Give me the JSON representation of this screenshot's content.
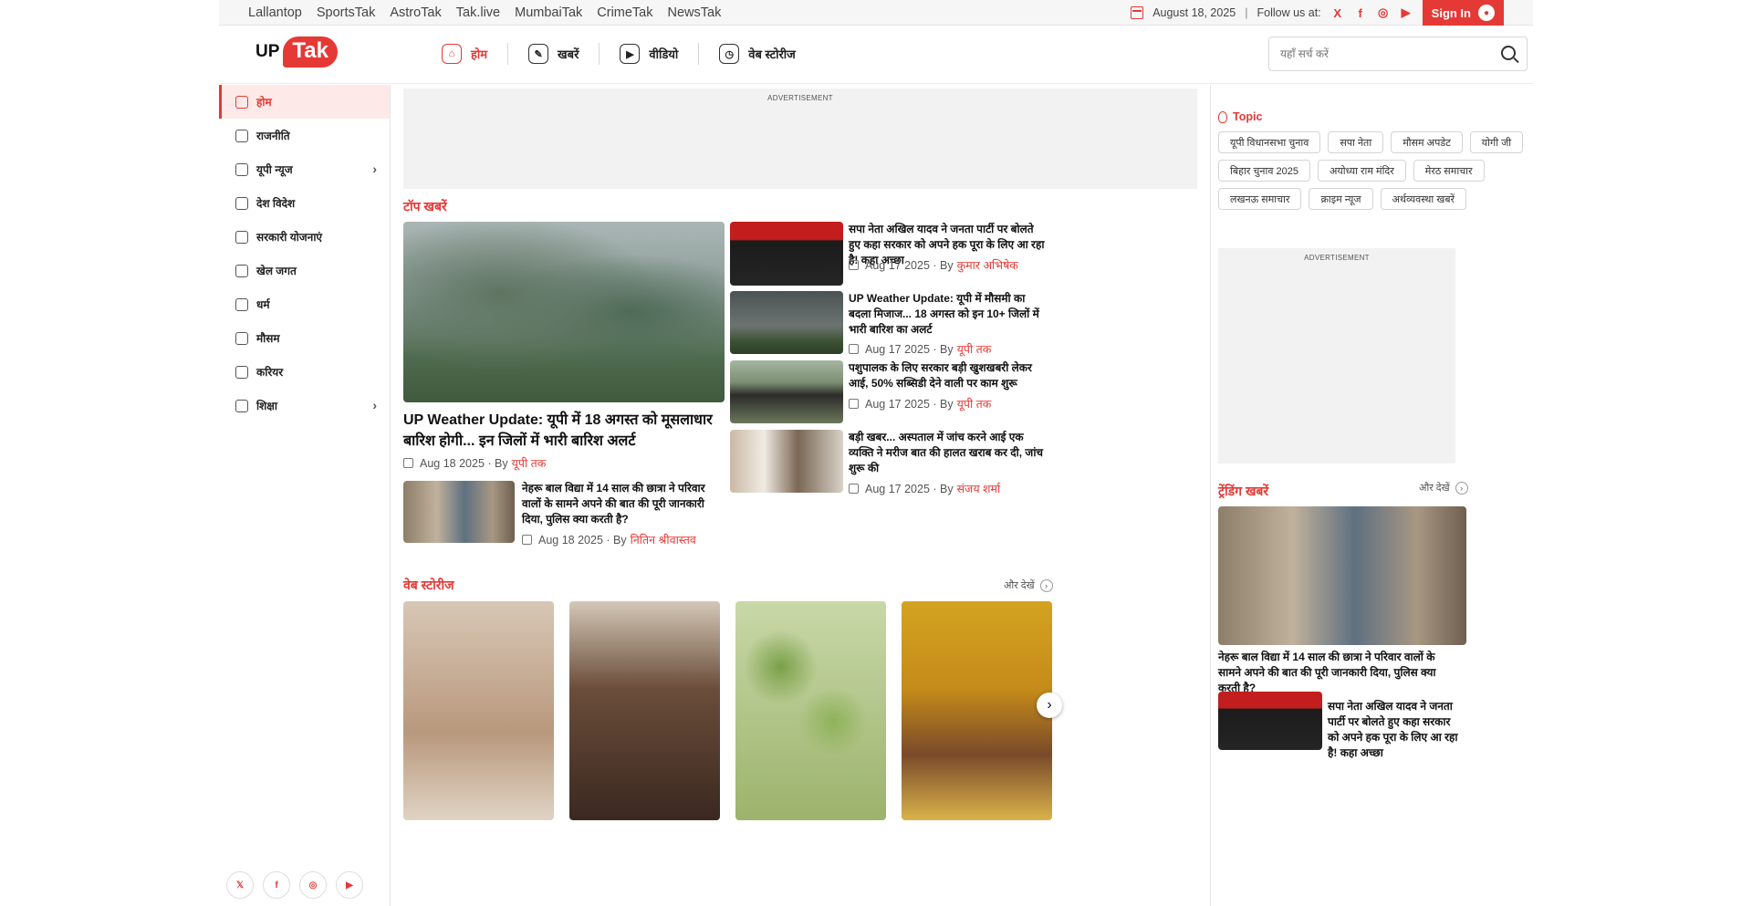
{
  "topbar": {
    "sister_sites": [
      "Lallantop",
      "SportsTak",
      "AstroTak",
      "Tak.live",
      "MumbaiTak",
      "CrimeTak",
      "NewsTak"
    ],
    "date": "August 18, 2025",
    "separator": "|",
    "follow_label": "Follow us at:",
    "social": [
      "X",
      "f",
      "◎",
      "▶"
    ],
    "sign_in": "Sign In"
  },
  "header": {
    "logo_up": "UP",
    "logo_tak": "Tak",
    "nav": [
      {
        "label": "होम",
        "icon": "⌂"
      },
      {
        "label": "खबरें",
        "icon": "✎"
      },
      {
        "label": "वीडियो",
        "icon": "▶"
      },
      {
        "label": "वेब स्टोरीज",
        "icon": "◷"
      }
    ],
    "search_placeholder": "यहाँ सर्च करें"
  },
  "sidebar": {
    "items": [
      {
        "label": "होम",
        "chevron": false
      },
      {
        "label": "राजनीति",
        "chevron": false
      },
      {
        "label": "यूपी न्यूज",
        "chevron": true
      },
      {
        "label": "देश विदेश",
        "chevron": false
      },
      {
        "label": "सरकारी योजनाएं",
        "chevron": false
      },
      {
        "label": "खेल जगत",
        "chevron": false
      },
      {
        "label": "धर्म",
        "chevron": false
      },
      {
        "label": "मौसम",
        "chevron": false
      },
      {
        "label": "करियर",
        "chevron": false
      },
      {
        "label": "शिक्षा",
        "chevron": true
      }
    ],
    "footer_social": [
      "𝕏",
      "f",
      "◎",
      "▶"
    ]
  },
  "main": {
    "ad_label": "ADVERTISEMENT",
    "top_section": "टॉप खबरें",
    "lead": {
      "title": "UP Weather Update: यूपी में 18 अगस्त को मूसलाधार बारिश होगी... इन जिलों में भारी बारिश अलर्ट",
      "date": "Aug 18 2025 · By",
      "author": "यूपी तक"
    },
    "lead_bottom": {
      "title": "नेहरू बाल विद्या में 14 साल की छात्रा ने परिवार वालों के सामने अपने की बात की पूरी जानकारी दिया, पुलिस क्या करती है?",
      "date": "Aug 18 2025 · By",
      "author": "नितिन श्रीवास्तव"
    },
    "side_stories": [
      {
        "title": "सपा नेता अखिल यादव ने जनता पार्टी पर बोलते हुए कहा सरकार को अपने हक पूरा के लिए आ रहा है! कहा अच्छा",
        "date": "Aug 17 2025 · By",
        "author": "कुमार अभिषेक"
      },
      {
        "title": "UP Weather Update: यूपी में मौसमी का बदला मिजाज... 18 अगस्त को इन 10+ जिलों में भारी बारिश का अलर्ट",
        "date": "Aug 17 2025 · By",
        "author": "यूपी तक"
      },
      {
        "title": "पशुपालक के लिए सरकार बड़ी खुशखबरी लेकर आई, 50% सब्सिडी देने वाली पर काम शुरू",
        "date": "Aug 17 2025 · By",
        "author": "यूपी तक"
      },
      {
        "title": "बड़ी खबर... अस्पताल में जांच करने आई एक व्यक्ति ने मरीज बात की हालत खराब कर दी, जांच शुरू की",
        "date": "Aug 17 2025 · By",
        "author": "संजय शर्मा"
      }
    ],
    "web_stories_section": "वेब स्टोरीज",
    "see_more": "और देखें",
    "next": "›"
  },
  "right": {
    "topic_label": "Topic",
    "topics": [
      "यूपी विधानसभा चुनाव",
      "सपा नेता",
      "मौसम अपडेट",
      "योगी जी",
      "बिहार चुनाव 2025",
      "अयोध्या राम मंदिर",
      "मेरठ समाचार",
      "लखनऊ समाचार",
      "क्राइम न्यूज",
      "अर्थव्यवस्था खबरें"
    ],
    "ad_label": "ADVERTISEMENT",
    "trending_section": "ट्रेंडिंग खबरें",
    "see_more": "और देखें",
    "trending_main": "नेहरू बाल विद्या में 14 साल की छात्रा ने परिवार वालों के सामने अपने की बात की पूरी जानकारी दिया, पुलिस क्या करती है?",
    "trending_second": "सपा नेता अखिल यादव ने जनता पार्टी पर बोलते हुए कहा सरकार को अपने हक पूरा के लिए आ रहा है! कहा अच्छा"
  }
}
